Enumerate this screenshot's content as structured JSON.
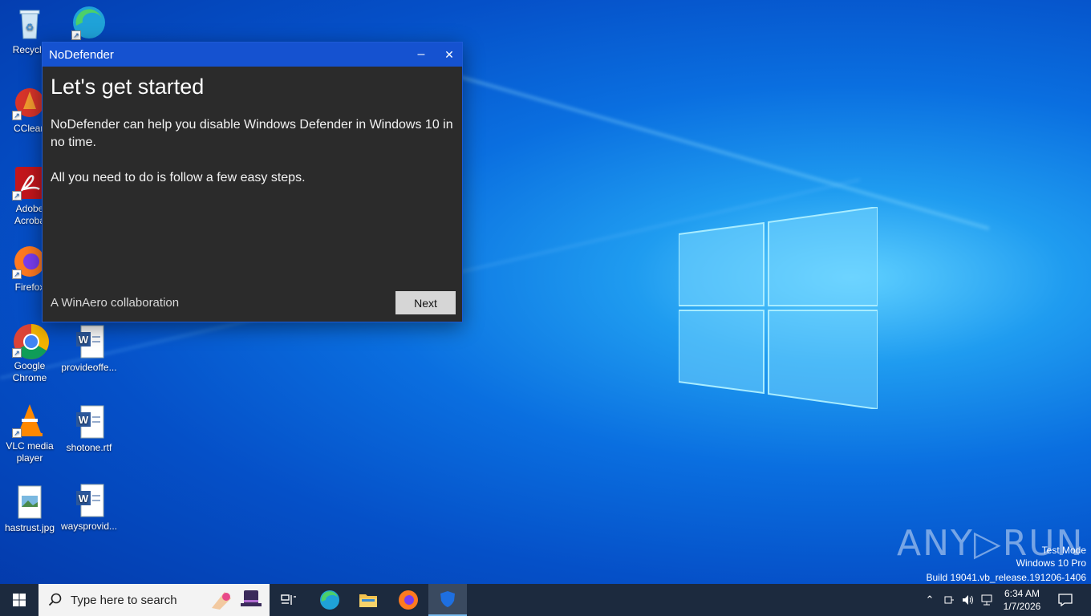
{
  "desktop": {
    "icons": [
      {
        "label": "Recycle",
        "name": "recycle-bin"
      },
      {
        "label": "",
        "name": "edge"
      },
      {
        "label": "CClean",
        "name": "ccleaner"
      },
      {
        "label": "Adobe Acroba",
        "name": "adobe-acrobat"
      },
      {
        "label": "Firefox",
        "name": "firefox"
      },
      {
        "label": "Google Chrome",
        "name": "google-chrome"
      },
      {
        "label": "provideoffe...",
        "name": "provideoffe-doc"
      },
      {
        "label": "VLC media player",
        "name": "vlc"
      },
      {
        "label": "shotone.rtf",
        "name": "shotone-doc"
      },
      {
        "label": "hastrust.jpg",
        "name": "hastrust-image"
      },
      {
        "label": "waysprovid...",
        "name": "waysprovid-doc"
      }
    ]
  },
  "window": {
    "title": "NoDefender",
    "heading": "Let's get started",
    "para1": "NoDefender can help you disable Windows Defender in Windows 10 in no time.",
    "para2": "All you need to do is follow a few easy steps.",
    "footer": "A WinAero collaboration",
    "next_label": "Next",
    "minimize_glyph": "–",
    "close_glyph": "✕"
  },
  "taskbar": {
    "search_placeholder": "Type here to search",
    "time": "6:34 AM",
    "date": "1/7/2026"
  },
  "watermark": {
    "line1": "Test Mode",
    "line2": "Windows 10 Pro",
    "line3": "Build 19041.vb_release.191206-1406",
    "brand": "ANY▷RUN"
  },
  "colors": {
    "titlebar": "#1552d0",
    "window_bg": "#2b2b2b",
    "taskbar": "#1c2a3e",
    "accent": "#0a6fe0"
  }
}
